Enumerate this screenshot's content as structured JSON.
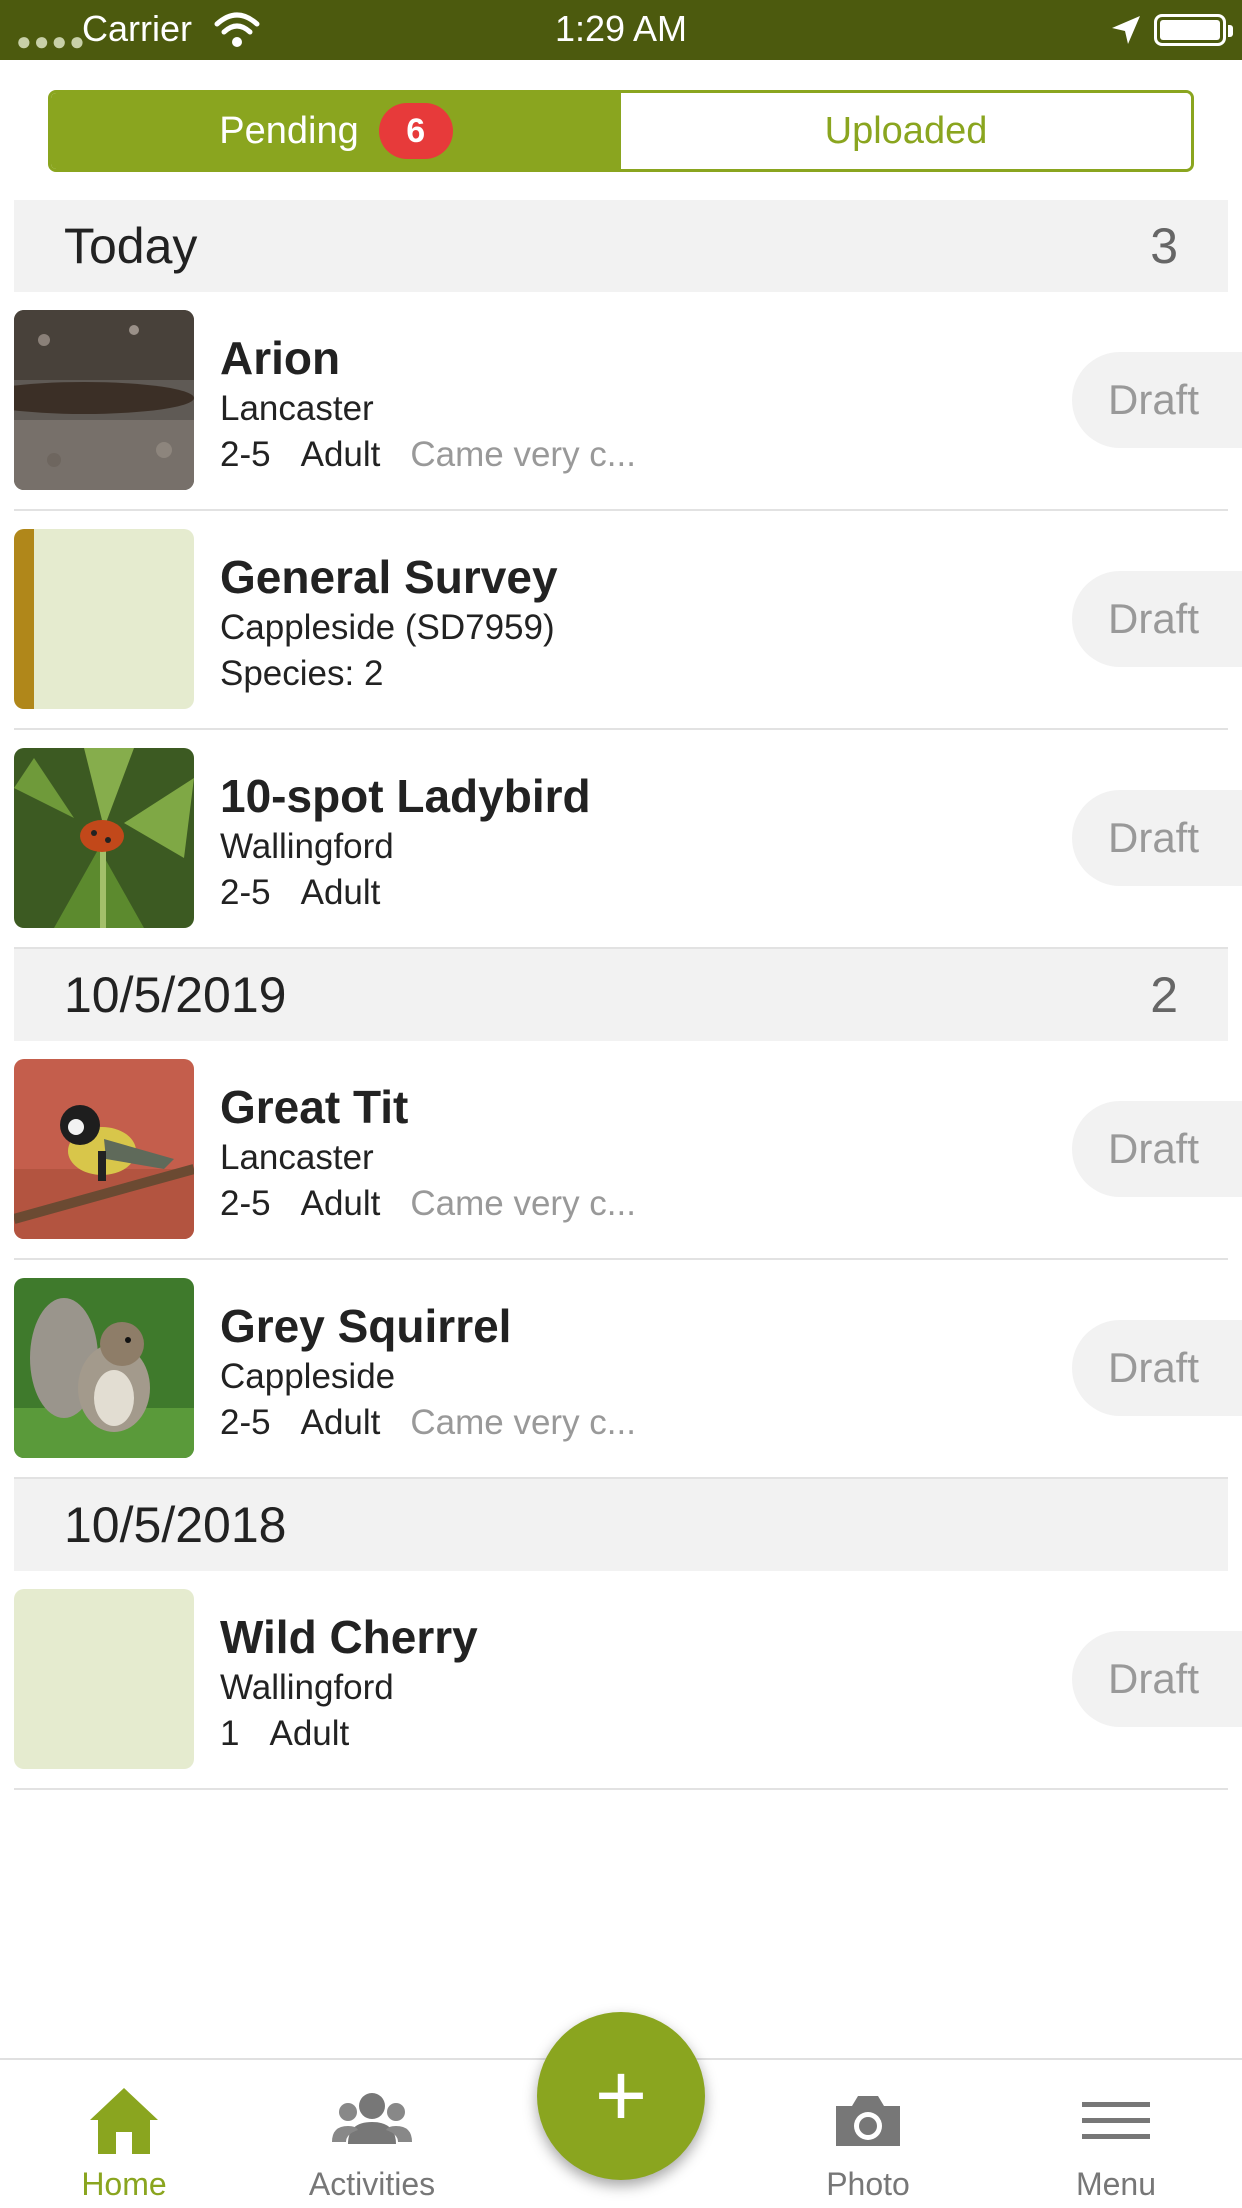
{
  "status_bar": {
    "carrier": "Carrier",
    "time": "1:29 AM"
  },
  "tabs_segment": {
    "pending_label": "Pending",
    "pending_count": "6",
    "uploaded_label": "Uploaded"
  },
  "sections": [
    {
      "title": "Today",
      "count": "3",
      "records": [
        {
          "title": "Arion",
          "location": "Lancaster",
          "count": "2-5",
          "stage": "Adult",
          "comment": "Came very c...",
          "status": "Draft",
          "thumb_icon": "slug-photo"
        },
        {
          "title": "General Survey",
          "location": "Cappleside (SD7959)",
          "species": "Species: 2",
          "status": "Draft",
          "thumb_icon": "survey-placeholder"
        },
        {
          "title": "10-spot Ladybird",
          "location": "Wallingford",
          "count": "2-5",
          "stage": "Adult",
          "status": "Draft",
          "thumb_icon": "ladybird-photo"
        }
      ]
    },
    {
      "title": "10/5/2019",
      "count": "2",
      "records": [
        {
          "title": "Great Tit",
          "location": "Lancaster",
          "count": "2-5",
          "stage": "Adult",
          "comment": "Came very c...",
          "status": "Draft",
          "thumb_icon": "bird-photo"
        },
        {
          "title": "Grey Squirrel",
          "location": "Cappleside",
          "count": "2-5",
          "stage": "Adult",
          "comment": "Came very c...",
          "status": "Draft",
          "thumb_icon": "squirrel-photo"
        }
      ]
    },
    {
      "title": "10/5/2018",
      "records": [
        {
          "title": "Wild Cherry",
          "location": "Wallingford",
          "count": "1",
          "stage": "Adult",
          "status": "Draft",
          "thumb_icon": "placeholder"
        }
      ]
    }
  ],
  "tab_bar": {
    "home": "Home",
    "activities": "Activities",
    "add": "+",
    "photo": "Photo",
    "menu": "Menu"
  },
  "colors": {
    "accent": "#8aa51f",
    "status_bar": "#4c5a0e",
    "badge": "#e73a3a"
  }
}
